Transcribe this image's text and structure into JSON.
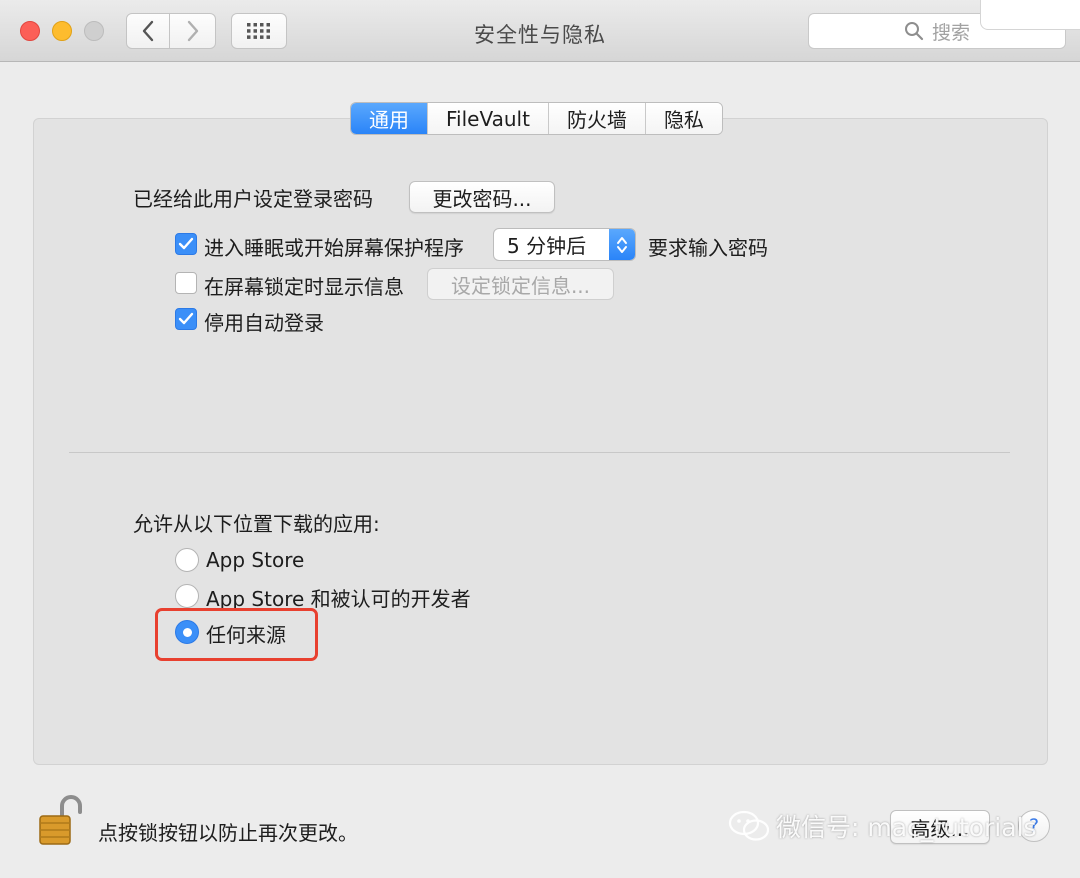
{
  "window": {
    "title": "安全性与隐私"
  },
  "search": {
    "placeholder": "搜索"
  },
  "tabs": [
    {
      "label": "通用",
      "active": true
    },
    {
      "label": "FileVault",
      "active": false
    },
    {
      "label": "防火墙",
      "active": false
    },
    {
      "label": "隐私",
      "active": false
    }
  ],
  "general": {
    "password_label": "已经给此用户设定登录密码",
    "change_password_button": "更改密码...",
    "sleep_checkbox": {
      "label": "进入睡眠或开始屏幕保护程序",
      "checked": true
    },
    "sleep_delay": {
      "value": "5 分钟后"
    },
    "require_password_label": "要求输入密码",
    "lock_message_checkbox": {
      "label": "在屏幕锁定时显示信息",
      "checked": false
    },
    "set_lock_message_button": "设定锁定信息...",
    "disable_autologin_checkbox": {
      "label": "停用自动登录",
      "checked": true
    }
  },
  "downloads": {
    "label": "允许从以下位置下载的应用:",
    "options": [
      {
        "label": "App Store",
        "selected": false
      },
      {
        "label": "App Store 和被认可的开发者",
        "selected": false
      },
      {
        "label": "任何来源",
        "selected": true
      }
    ]
  },
  "footer": {
    "lock_label": "点按锁按钮以防止再次更改。",
    "advanced_button": "高级...",
    "help": "?"
  },
  "watermark": {
    "text": "微信号: mac_tutorials"
  },
  "colors": {
    "accent": "#3b8ff8",
    "highlight": "#e8402f"
  }
}
